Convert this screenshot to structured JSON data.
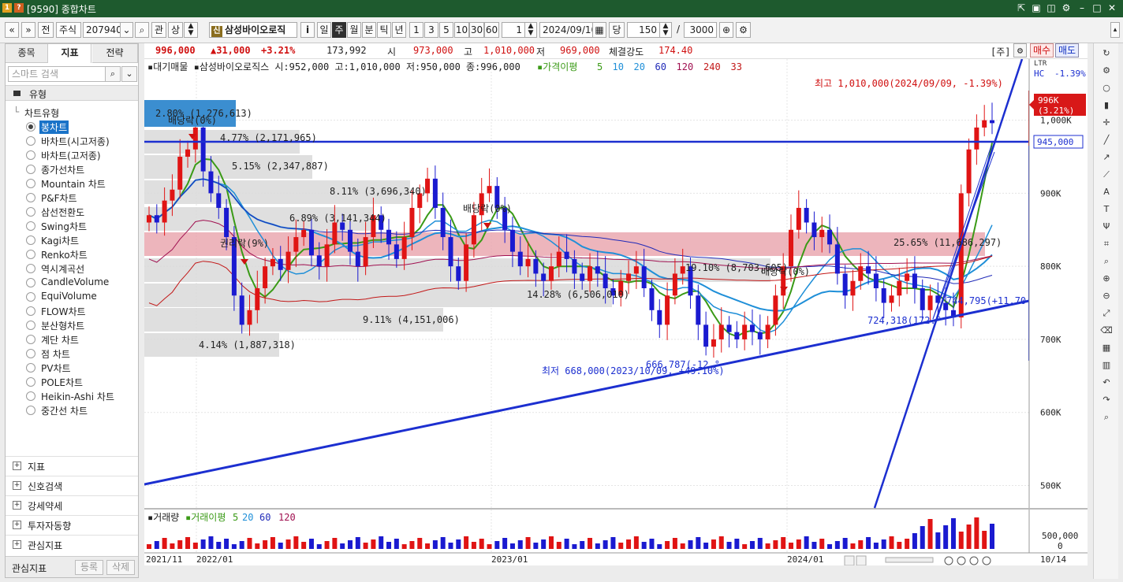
{
  "window": {
    "title": "[9590] 종합차트",
    "icons": [
      "info-icon",
      "help-icon"
    ],
    "window_buttons": [
      "link-icon",
      "window-icon",
      "capture-icon",
      "gear-icon",
      "minimize-icon",
      "maximize-icon",
      "close-icon"
    ]
  },
  "toolbar": {
    "nav_prev": "«",
    "nav_down": "»",
    "prev_label": "전",
    "market": "주식",
    "code": "207940",
    "watch_label": "관",
    "order_label": "상",
    "badge": "신",
    "stock_name": "삼성바이오로직",
    "info_label": "i",
    "periods": [
      "일",
      "주",
      "월",
      "분",
      "틱",
      "년"
    ],
    "active_period": "주",
    "intervals": [
      "1",
      "3",
      "5",
      "10",
      "30",
      "60"
    ],
    "unit_value": "1",
    "date": "2024/09/10",
    "date_label": "당",
    "count": "150",
    "total": "3000",
    "slash": "/"
  },
  "left_panel": {
    "tabs": [
      "종목",
      "지표",
      "전략"
    ],
    "active_tab": "지표",
    "search_placeholder": "스마트 검색",
    "section": "유형",
    "tree_root": "차트유형",
    "chart_types": [
      "봉차트",
      "바차트(시고저종)",
      "바차트(고저종)",
      "종가선차트",
      "Mountain 차트",
      "P&F차트",
      "삼선전환도",
      "Swing차트",
      "Kagi차트",
      "Renko차트",
      "역시계곡선",
      "CandleVolume",
      "EquiVolume",
      "FLOW차트",
      "분산형차트",
      "계단 차트",
      "점 차트",
      "PV차트",
      "POLE차트",
      "Heikin-Ashi 차트",
      "중간선 차트"
    ],
    "selected_type": "봉차트",
    "groups": [
      "지표",
      "신호검색",
      "강세약세",
      "투자자동향",
      "관심지표"
    ],
    "footer_label": "관심지표",
    "footer_buttons": [
      "등록",
      "삭제"
    ]
  },
  "price_info": {
    "price": "996,000",
    "change": "▲31,000",
    "change_pct": "+3.21%",
    "volume": "173,992",
    "open_label": "시",
    "open": "973,000",
    "high_label": "고",
    "high": "1,010,000",
    "low_label": "저",
    "low": "969,000",
    "strength_label": "체결강도",
    "strength": "174.40",
    "week_tag": "[주]",
    "buy_label": "매수",
    "sell_label": "매도"
  },
  "legend": {
    "prefix": "▪대기매물 ▪삼성바이오로직스 시:952,000 고:1,010,000 저:950,000 종:996,000",
    "ma_label": "▪가격이평",
    "ma_periods": [
      "5",
      "10",
      "20",
      "60",
      "120",
      "240",
      "33"
    ],
    "ma_colors": [
      "#3a9a16",
      "#1f8fd8",
      "#1f8fd8",
      "#202ab8",
      "#a01050",
      "#c21818",
      "#c21818"
    ]
  },
  "chart_data": {
    "type": "candlestick",
    "y_ticks": [
      "1,000K",
      "900K",
      "800K",
      "700K",
      "600K",
      "500K"
    ],
    "ylim": [
      480000,
      1060000
    ],
    "x_ticks": [
      "2021/11",
      "2022/01",
      "2023/01",
      "2024/01",
      "10/14"
    ],
    "hline": "945,000",
    "current_tag": "996K",
    "current_pct": "(3.21%)",
    "hc_label": "HC",
    "hc_value": "-1.39%",
    "scale_tag": "LTR",
    "max_note": "최고 1,010,000(2024/09/09, -1.39%)",
    "min_note": "최저 668,000(2023/10/09, +49.10%)",
    "line_notes": [
      "666,787(-12.°",
      "744,795(+11.70 %)",
      "724,318(172.°"
    ],
    "dividend_notes": [
      "배당락(0%)",
      "권리락(9%)",
      "배당락(0%)",
      "배당락(0%)"
    ],
    "volume_profile": [
      "2.80% (1,276,613)",
      "4.77% (2,171,965)",
      "5.15% (2,347,887)",
      "8.11% (3,696,340)",
      "6.89% (3,141,344)",
      "25.65% (11,686,297)",
      "19.10% (8,703,605)",
      "14.28% (6,506,010)",
      "9.11% (4,151,006)",
      "4.14% (1,887,318)"
    ],
    "close_series": [
      870,
      860,
      890,
      905,
      950,
      960,
      990,
      930,
      900,
      880,
      840,
      760,
      720,
      740,
      770,
      800,
      810,
      795,
      820,
      840,
      850,
      815,
      800,
      830,
      860,
      850,
      820,
      800,
      840,
      870,
      850,
      830,
      810,
      840,
      880,
      900,
      920,
      880,
      840,
      800,
      780,
      830,
      870,
      900,
      910,
      880,
      850,
      820,
      800,
      810,
      790,
      780,
      800,
      820,
      810,
      790,
      780,
      800,
      790,
      770,
      760,
      780,
      790,
      800,
      770,
      740,
      720,
      760,
      790,
      800,
      760,
      720,
      690,
      700,
      720,
      710,
      700,
      720,
      710,
      700,
      720,
      760,
      800,
      850,
      880,
      860,
      840,
      850,
      830,
      790,
      760,
      780,
      800,
      790,
      770,
      750,
      760,
      780,
      790,
      770,
      740,
      760,
      750,
      740,
      730,
      900,
      960,
      990,
      1000,
      996
    ],
    "volume_chart": {
      "title": "▪거래량",
      "ma_label": "▪거래이평",
      "ma_periods": [
        "5",
        "20",
        "60",
        "120"
      ],
      "y_ticks": [
        "500,000",
        "0"
      ]
    }
  },
  "right_tools": [
    "refresh-icon",
    "settings-icon",
    "circle-icon",
    "bar-icon",
    "cross-icon",
    "line-icon",
    "ray-icon",
    "trend-icon",
    "auto-icon",
    "text-icon",
    "fib-icon",
    "pattern-icon",
    "zoom-icon",
    "zoom-in-icon",
    "zoom-out-icon",
    "measure-icon",
    "delete-icon",
    "grid-icon",
    "columns-icon",
    "undo-icon",
    "redo-icon",
    "search-icon"
  ]
}
